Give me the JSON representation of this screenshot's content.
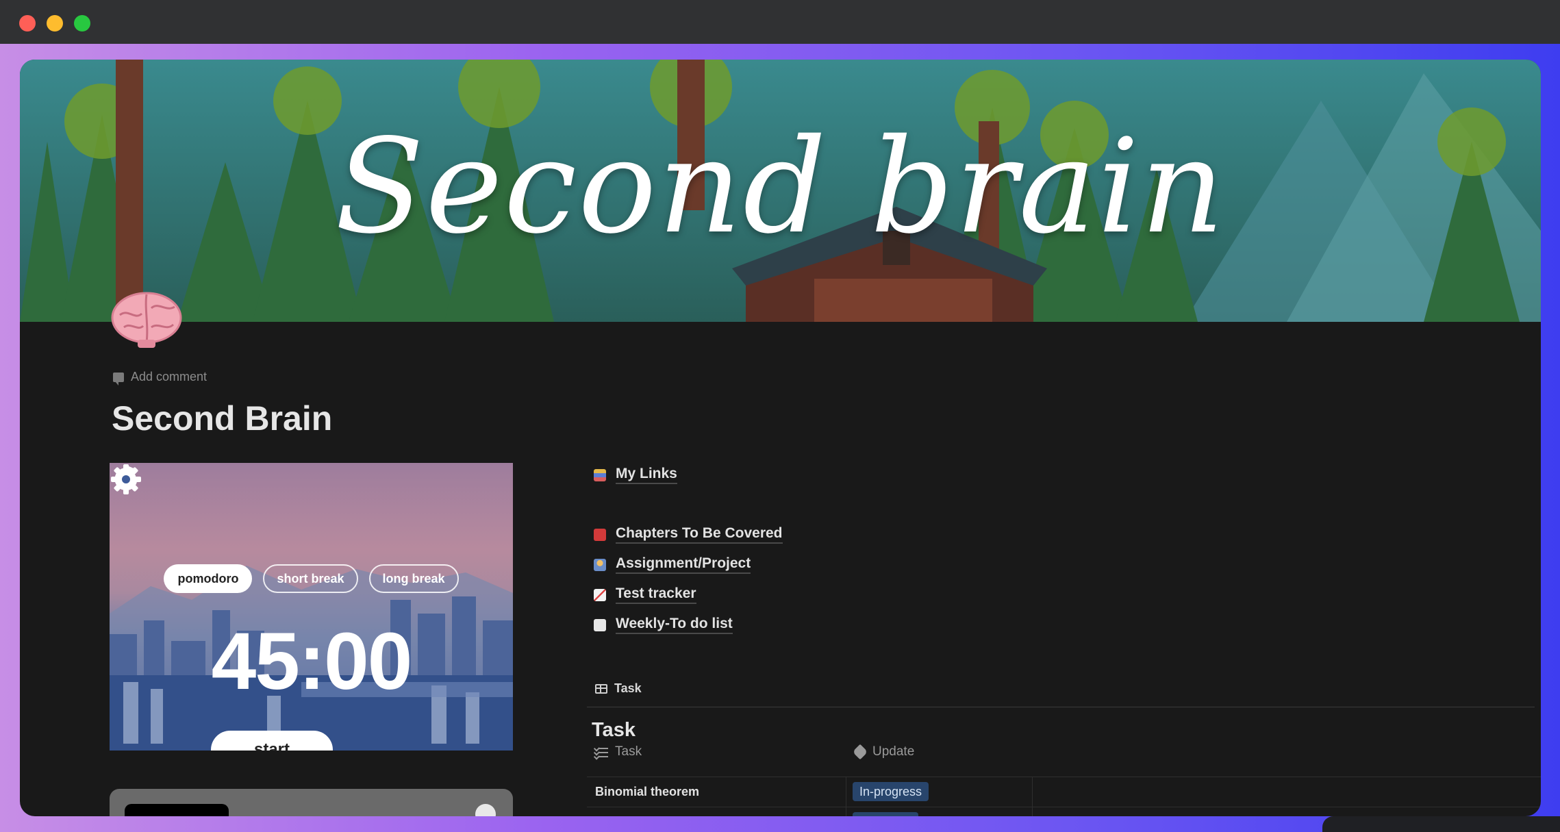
{
  "window": {
    "traffic_lights": [
      "close",
      "minimize",
      "maximize"
    ]
  },
  "cover": {
    "title": "Second brain"
  },
  "page": {
    "icon": "brain-emoji",
    "add_comment": "Add comment",
    "title": "Second Brain"
  },
  "timer": {
    "modes": [
      "pomodoro",
      "short break",
      "long break"
    ],
    "active_mode": "pomodoro",
    "time": "45:00",
    "start_label": "start"
  },
  "links": [
    {
      "icon": "books-emoji",
      "label": "My Links"
    },
    {
      "icon": "red-book-emoji",
      "label": "Chapters To Be Covered"
    },
    {
      "icon": "student-emoji",
      "label": "Assignment/Project"
    },
    {
      "icon": "chart-increasing-emoji",
      "label": "Test tracker"
    },
    {
      "icon": "page-emoji",
      "label": "Weekly-To do list"
    }
  ],
  "database": {
    "view_label": "Task",
    "title": "Task",
    "columns": [
      "Task",
      "Update"
    ],
    "rows": [
      {
        "task": "Binomial theorem",
        "update": "In-progress"
      }
    ]
  },
  "colors": {
    "page_bg": "#191919",
    "status_badge": "#28456c",
    "accent_gradient": [
      "#c78ee6",
      "#3e3df0"
    ]
  }
}
